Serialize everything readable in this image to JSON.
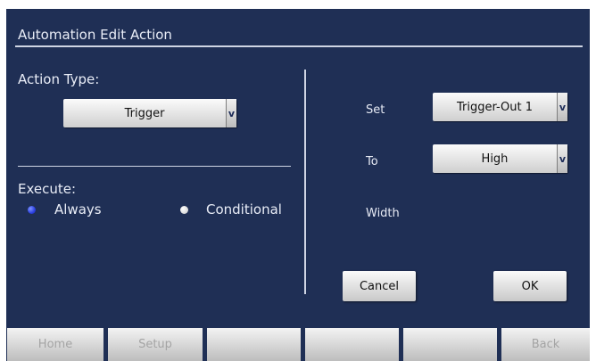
{
  "dialog": {
    "title": "Automation Edit Action"
  },
  "action_type": {
    "label": "Action Type:",
    "value": "Trigger",
    "arrow": "v"
  },
  "execute": {
    "label": "Execute:",
    "options": [
      {
        "label": "Always",
        "selected": true
      },
      {
        "label": "Conditional",
        "selected": false
      }
    ]
  },
  "set": {
    "label": "Set",
    "value": "Trigger-Out 1",
    "arrow": "v"
  },
  "to": {
    "label": "To",
    "value": "High",
    "arrow": "v"
  },
  "width": {
    "label": "Width"
  },
  "buttons": {
    "cancel": "Cancel",
    "ok": "OK"
  },
  "softkeys": [
    "Home",
    "Setup",
    "",
    "",
    "",
    "Back"
  ],
  "colors": {
    "background": "#1f2f55",
    "radio_selected": "#2b3fe0",
    "softkey_disabled_text": "#a4a4a4"
  }
}
